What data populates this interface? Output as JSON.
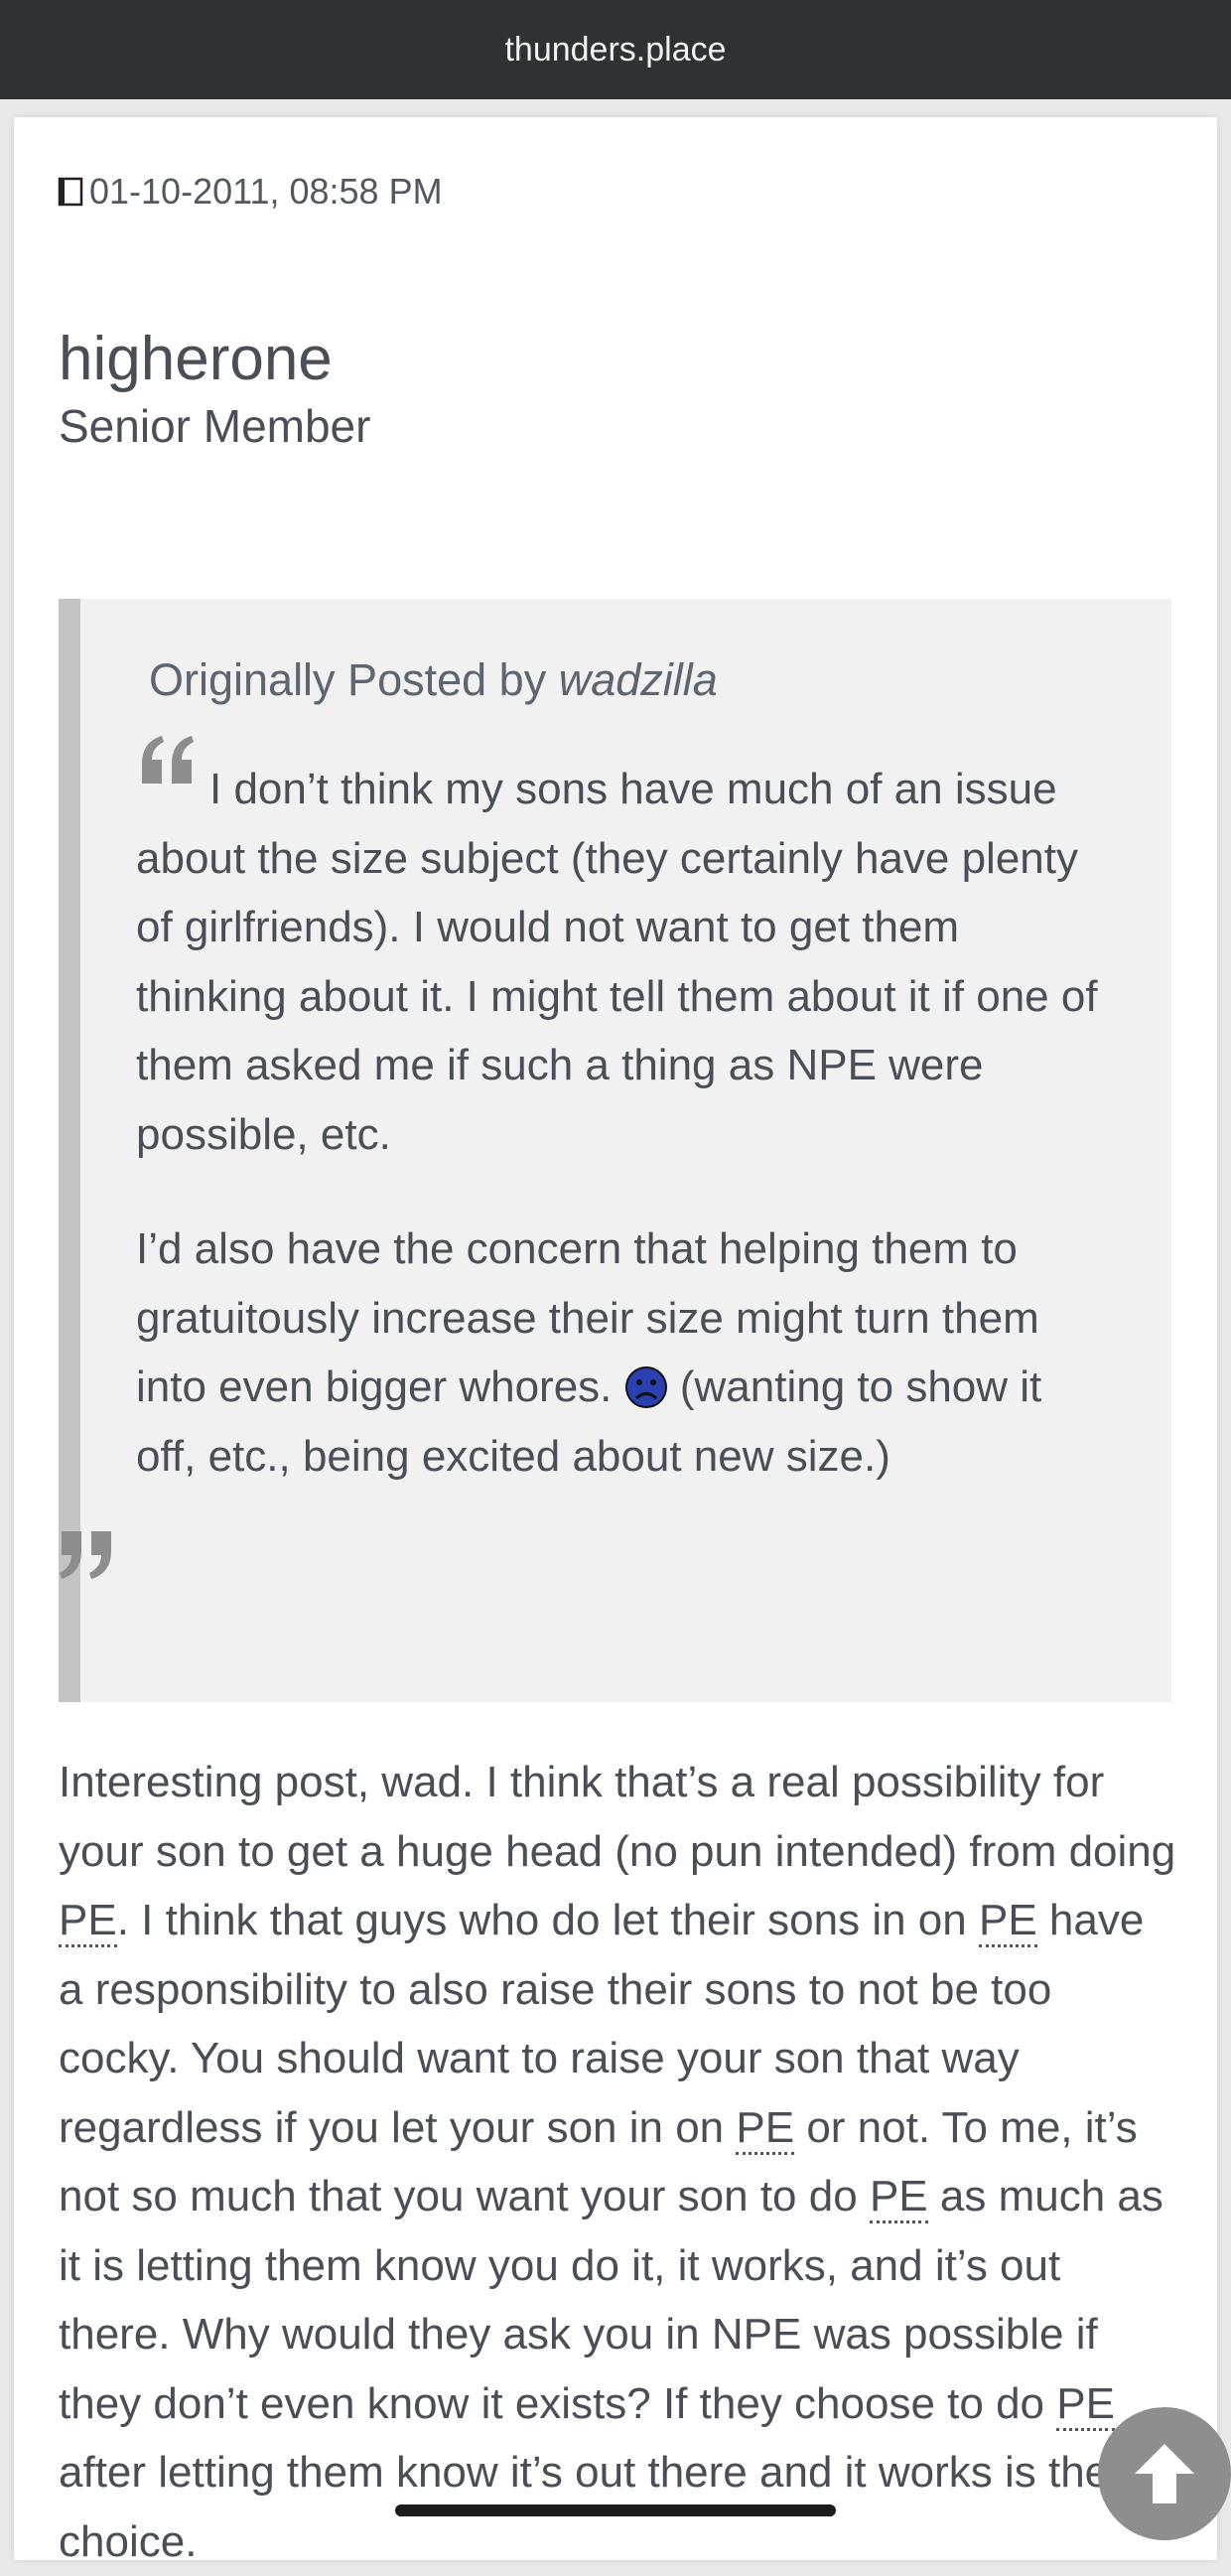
{
  "browser": {
    "url": "thunders.place"
  },
  "post": {
    "date": "01-10-2011, 08:58 PM",
    "username": "higherone",
    "user_title": "Senior Member",
    "quote": {
      "prefix": "Originally Posted by",
      "author": "wadzilla",
      "paragraph1": "I don’t think my sons have much of an issue about the size subject (they certainly have plenty of girlfriends). I would not want to get them thinking about it. I might tell them about it if one of them asked me if such a thing as NPE were possible, etc.",
      "paragraph2_before": "I’d also have the concern that helping them to gratuitously increase their size might turn them into even bigger whores.",
      "paragraph2_after": "(wanting to show it off, etc., being excited about new size.)"
    },
    "body": {
      "abbr": "PE",
      "s1": "Interesting post, wad. I think that’s a real possibility for your son to get a huge head (no pun intended) from doing",
      "s2": ". I think that guys who do let their sons in on",
      "s3": "have a responsibility to also raise their sons to not be too cocky. You should want to raise your son that way regardless if you let your son in on",
      "s4": "or not. To me, it’s not so much that you want your son to do",
      "s5": "as much as it is letting them know you do it, it works, and it’s out there. Why would they ask you in NPE was possible if they don’t even know it exists? If they choose to do",
      "s6": "after letting them know it’s out there and it works is their choice."
    }
  },
  "icons": {
    "post_icon": "document-icon",
    "smiley": "frown-smiley-icon",
    "scroll_top": "arrow-up-icon"
  },
  "colors": {
    "url_bar": "#2f3133",
    "quote_background": "#f1f1f1",
    "quote_bar": "#c4c4c4",
    "text": "#4a4f57",
    "smiley": "#2a3fb0"
  }
}
